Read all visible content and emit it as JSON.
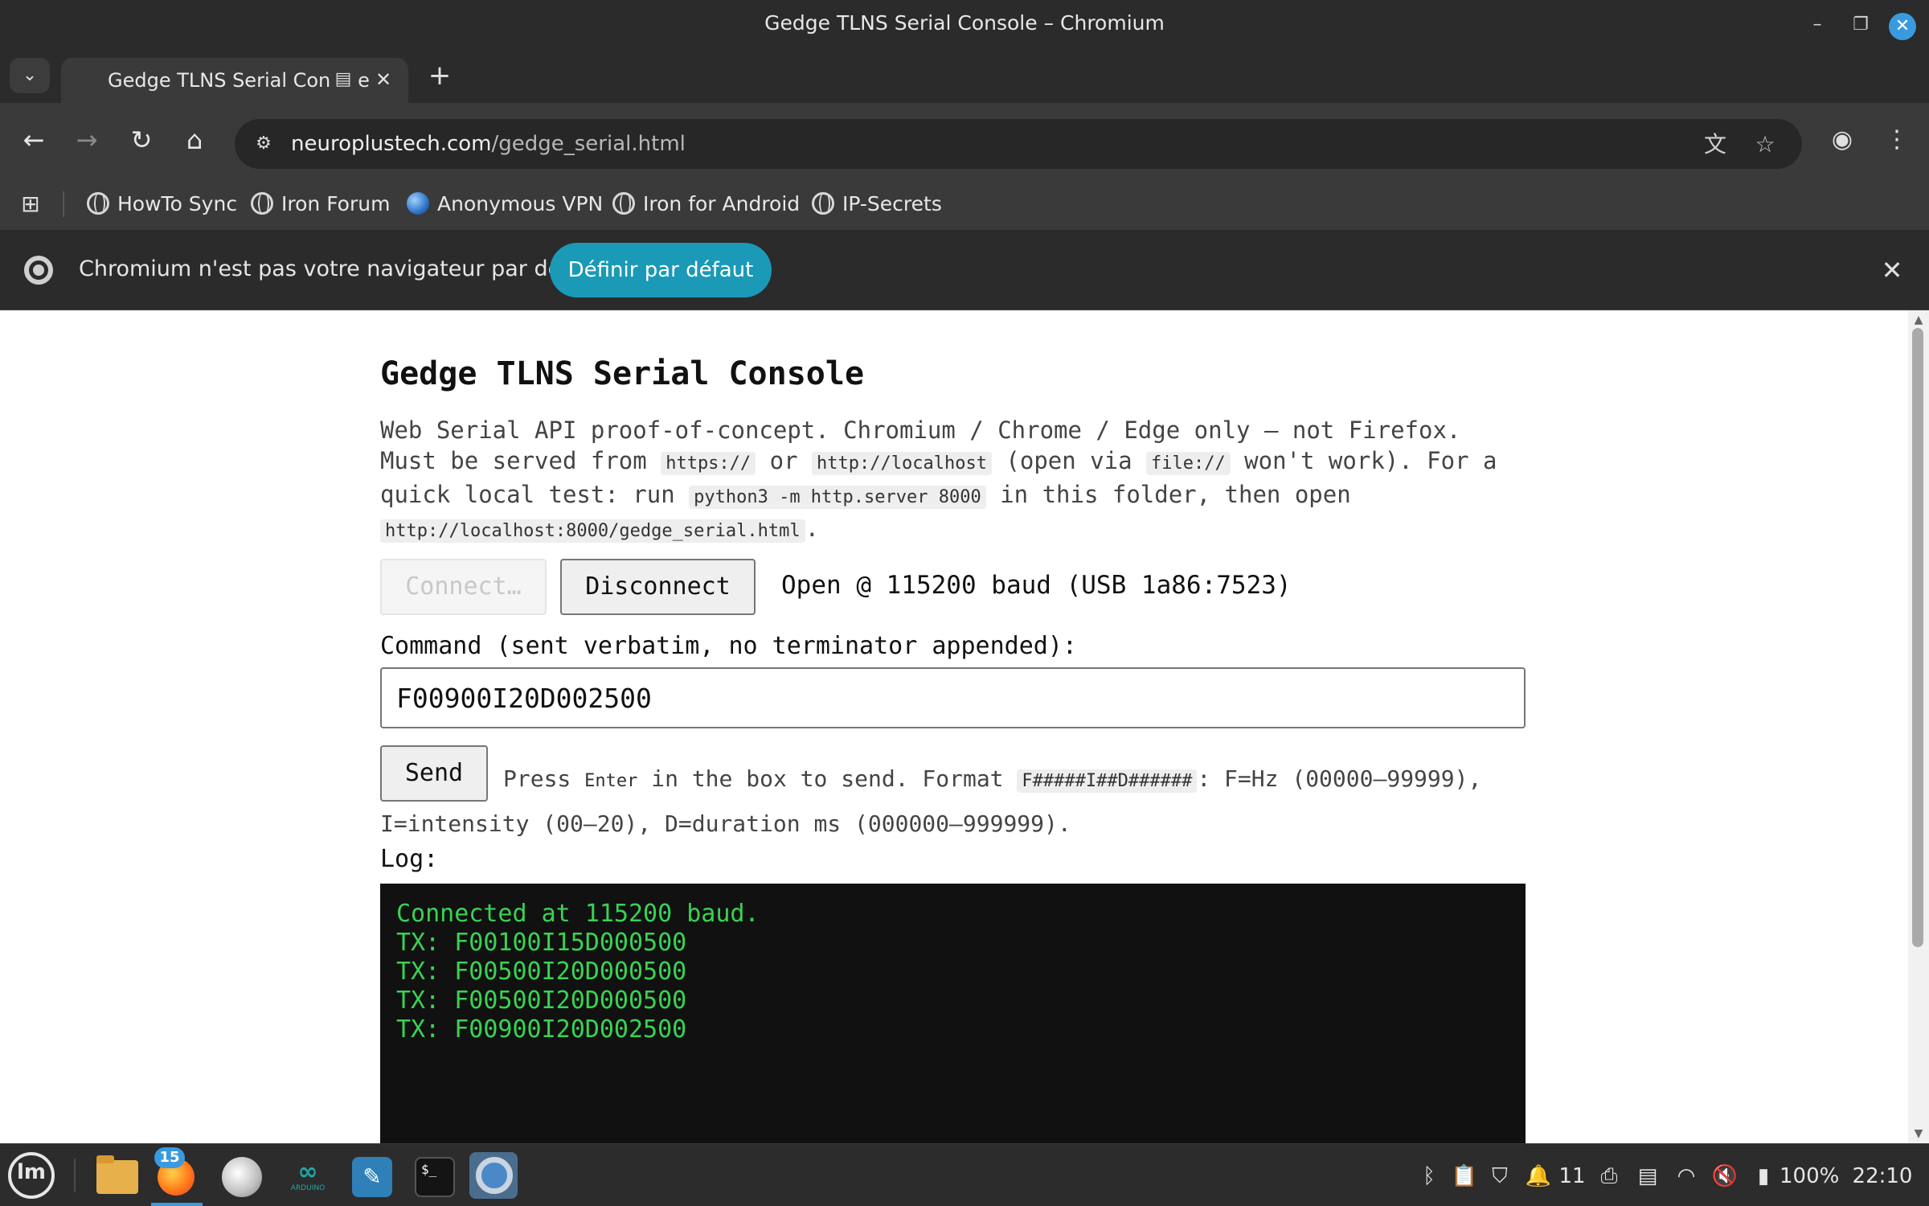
{
  "window": {
    "title": "Gedge TLNS Serial Console – Chromium",
    "minimize_icon": "minimize-icon",
    "maximize_icon": "maximize-icon",
    "close_icon": "close-icon"
  },
  "tab": {
    "title": "Gedge TLNS Serial Console",
    "new_tab_icon": "plus-icon"
  },
  "toolbar": {
    "url_host": "neuroplustech.com",
    "url_path": "/gedge_serial.html"
  },
  "bookmarks": [
    {
      "label": "HowTo Sync",
      "icon": "globe-icon"
    },
    {
      "label": "Iron Forum",
      "icon": "globe-icon"
    },
    {
      "label": "Anonymous VPN",
      "icon": "vpn-globe-icon"
    },
    {
      "label": "Iron for Android",
      "icon": "globe-icon"
    },
    {
      "label": "IP-Secrets",
      "icon": "globe-icon"
    }
  ],
  "infobar": {
    "message": "Chromium n'est pas votre navigateur par défaut",
    "button": "Définir par défaut"
  },
  "page": {
    "heading": "Gedge TLNS Serial Console",
    "desc": {
      "p1": "Web Serial API proof-of-concept. Chromium / Chrome / Edge only — not Firefox. Must be served from ",
      "c1": "https://",
      "p2": " or ",
      "c2": "http://localhost",
      "p3": " (open via ",
      "c3": "file://",
      "p4": " won't work). For a quick local test: run ",
      "c4": "python3 -m http.server 8000",
      "p5": " in this folder, then open ",
      "c5": "http://localhost:8000/gedge_serial.html",
      "p6": "."
    },
    "connect_label": "Connect…",
    "disconnect_label": "Disconnect",
    "status": "Open @ 115200 baud (USB 1a86:7523)",
    "command_label": "Command (sent verbatim, no terminator appended):",
    "command_value": "F00900I20D002500",
    "send_label": "Send",
    "hint": {
      "p1": "Press ",
      "kbd": "Enter",
      "p2": " in the box to send. Format ",
      "fmt": "F#####I##D######",
      "p3": ": F=Hz (00000–99999), I=intensity (00–20), D=duration ms (000000–999999)."
    },
    "log_label": "Log:",
    "log_lines": [
      "Connected at 115200 baud.",
      "TX: F00100I15D000500",
      "TX: F00500I20D000500",
      "TX: F00500I20D000500",
      "TX: F00900I20D002500"
    ]
  },
  "taskbar": {
    "firefox_badge": "15",
    "arduino_caption": "ARDUINO",
    "notifications_count": "11",
    "battery": "100%",
    "clock": "22:10"
  },
  "colors": {
    "accent": "#1a9ab7",
    "log_bg": "#111111",
    "log_text": "#39d353",
    "taskbar_accent": "#3a9ae0"
  }
}
